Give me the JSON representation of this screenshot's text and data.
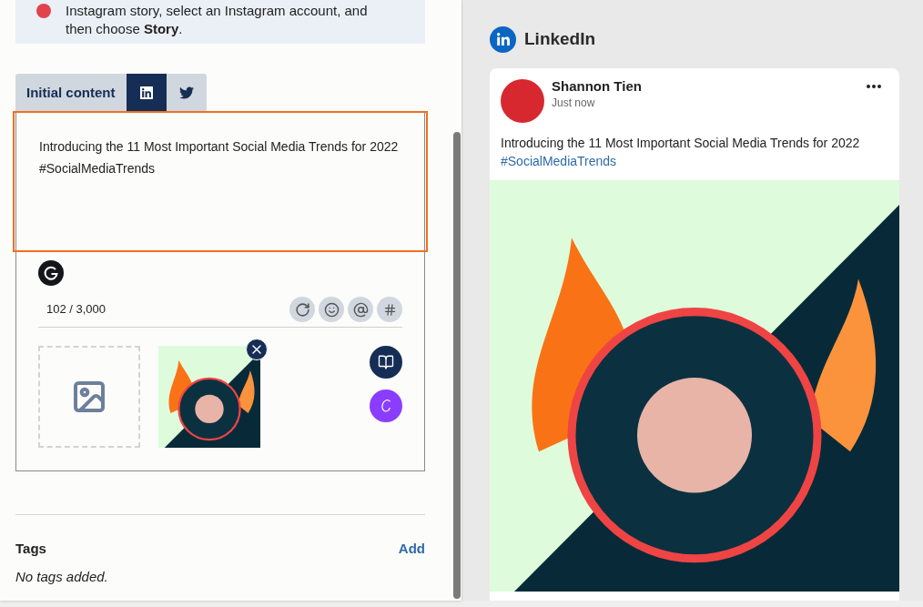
{
  "banner": {
    "text": "Instagram story, select an Instagram account, and then choose **Story**."
  },
  "editor": {
    "tabs": [
      {
        "kind": "text",
        "label": "Initial content",
        "selected": false
      },
      {
        "kind": "linkedin",
        "selected": true
      },
      {
        "kind": "twitter",
        "selected": false
      }
    ],
    "text": "Introducing the 11 Most Important Social Media Trends for 2022 #SocialMediaTrends",
    "counter": "102 / 3,000"
  },
  "tags": {
    "title": "Tags",
    "action": "Add",
    "empty_text": "No tags added."
  },
  "preview": {
    "network": "LinkedIn",
    "post": {
      "author": "Shannon Tien",
      "time": "Just now",
      "text": "Introducing the 11 Most Important Social Media Trends for 2022",
      "hashtag": "#SocialMediaTrends"
    }
  }
}
